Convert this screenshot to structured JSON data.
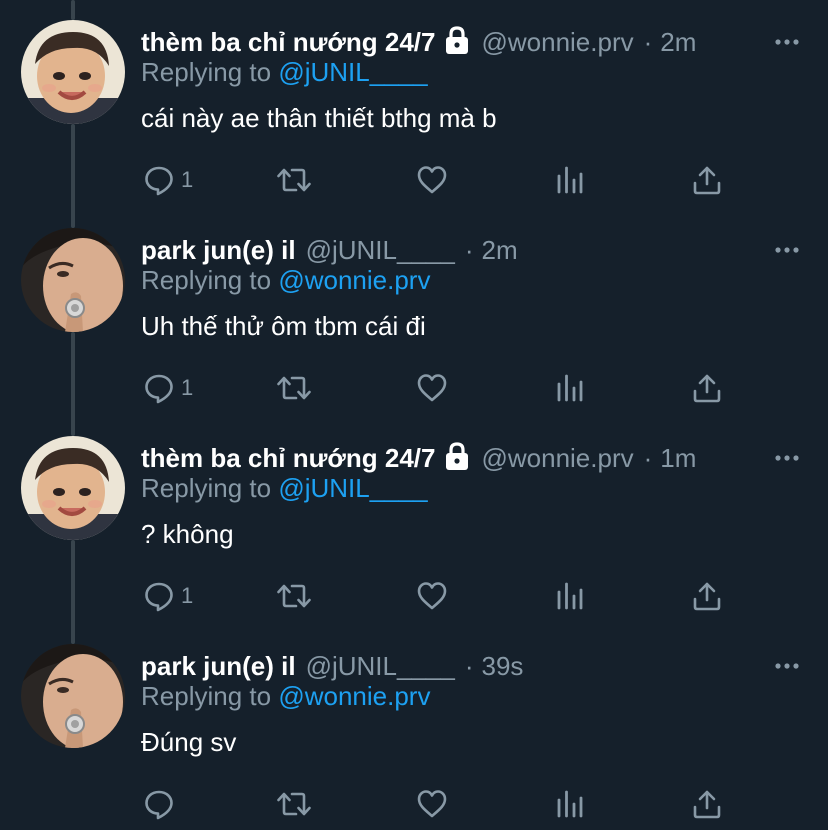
{
  "colors": {
    "background": "#15202b",
    "text_primary": "#ffffff",
    "text_secondary": "#8899a6",
    "link": "#1da1f2",
    "thread_line": "#38444d"
  },
  "reply_prefix": "Replying to",
  "tweets": [
    {
      "display_name": "thèm ba chỉ nướng 24/7",
      "protected_icon": "lock-icon",
      "handle": "@wonnie.prv",
      "separator": "·",
      "time": "2m",
      "replying_to": "@jUNIL____",
      "text": "cái này ae thân thiết bthg mà b",
      "reply_count": "1",
      "avatar": "child-avatar"
    },
    {
      "display_name": "park jun(e) il",
      "protected_icon": "",
      "handle": "@jUNIL____",
      "separator": "·",
      "time": "2m",
      "replying_to": "@wonnie.prv",
      "text": "Uh thế thử ôm tbm cái đi",
      "reply_count": "1",
      "avatar": "man-avatar"
    },
    {
      "display_name": "thèm ba chỉ nướng 24/7",
      "protected_icon": "lock-icon",
      "handle": "@wonnie.prv",
      "separator": "·",
      "time": "1m",
      "replying_to": "@jUNIL____",
      "text": "? không",
      "reply_count": "1",
      "avatar": "child-avatar"
    },
    {
      "display_name": "park jun(e) il",
      "protected_icon": "",
      "handle": "@jUNIL____",
      "separator": "·",
      "time": "39s",
      "replying_to": "@wonnie.prv",
      "text": "Đúng sv",
      "reply_count": "",
      "avatar": "man-avatar"
    }
  ],
  "action_icons": [
    "reply-icon",
    "retweet-icon",
    "like-icon",
    "analytics-icon",
    "share-icon"
  ]
}
